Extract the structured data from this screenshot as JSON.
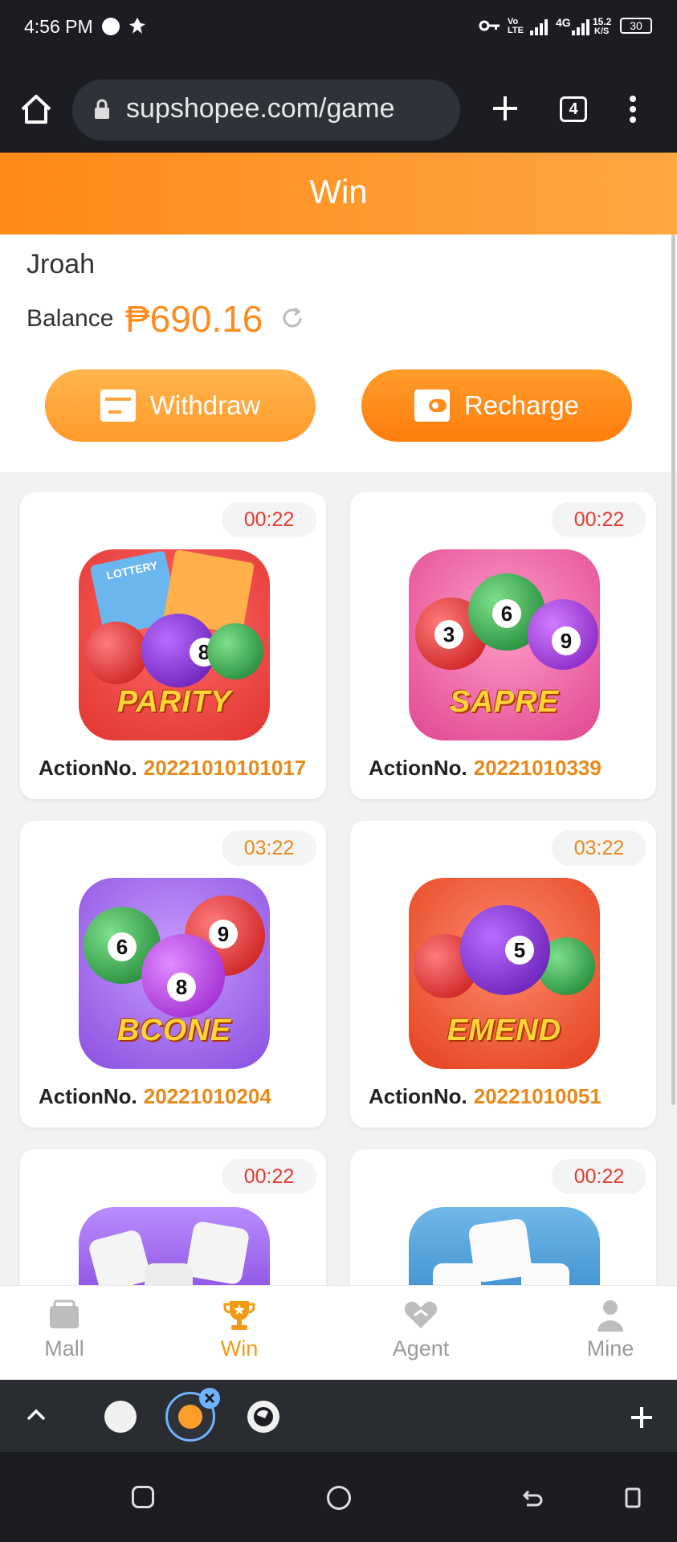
{
  "status_bar": {
    "time": "4:56 PM",
    "network_label": "4G",
    "volte_label": "Vo LTE",
    "speed": "15.2",
    "speed_unit": "K/S",
    "battery": "30"
  },
  "browser": {
    "url": "supshopee.com/game",
    "tab_count": "4"
  },
  "page": {
    "header_title": "Win",
    "username": "Jroah",
    "balance_label": "Balance",
    "balance_value": "₱690.16",
    "withdraw_label": "Withdraw",
    "recharge_label": "Recharge"
  },
  "games": [
    {
      "title": "PARITY",
      "timer": "00:22",
      "timer_color": "#e53b2e",
      "action_label": "ActionNo.",
      "action_no": "20221010101017",
      "lottery_label": "LOTTERY"
    },
    {
      "title": "SAPRE",
      "timer": "00:22",
      "timer_color": "#e53b2e",
      "action_label": "ActionNo.",
      "action_no": "20221010339"
    },
    {
      "title": "BCONE",
      "timer": "03:22",
      "timer_color": "#e8891a",
      "action_label": "ActionNo.",
      "action_no": "20221010204"
    },
    {
      "title": "EMEND",
      "timer": "03:22",
      "timer_color": "#e8891a",
      "action_label": "ActionNo.",
      "action_no": "20221010051"
    },
    {
      "title": "",
      "timer": "00:22",
      "timer_color": "#e53b2e"
    },
    {
      "title": "",
      "timer": "00:22",
      "timer_color": "#e53b2e"
    }
  ],
  "bottom_nav": {
    "items": [
      {
        "label": "Mall",
        "icon": "cart-icon",
        "active": false
      },
      {
        "label": "Win",
        "icon": "trophy-icon",
        "active": true
      },
      {
        "label": "Agent",
        "icon": "handshake-icon",
        "active": false
      },
      {
        "label": "Mine",
        "icon": "person-icon",
        "active": false
      }
    ]
  },
  "colors": {
    "accent": "#ff8c1a",
    "header_start": "#ff8a17",
    "header_end": "#ffa640",
    "timer_red": "#e53b2e",
    "action_orange": "#e8891a"
  }
}
